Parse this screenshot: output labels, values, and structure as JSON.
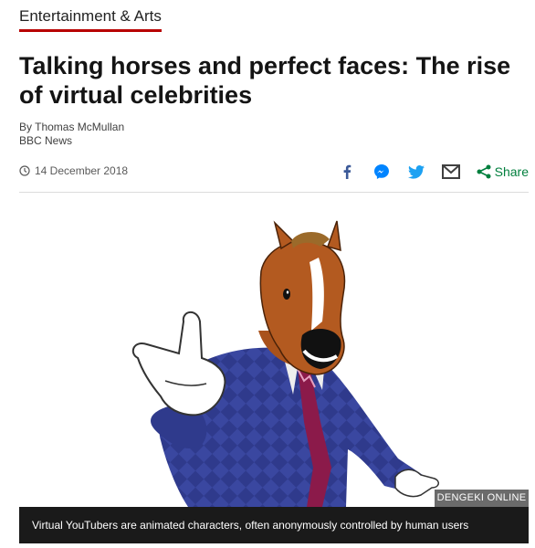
{
  "section": {
    "label": "Entertainment & Arts",
    "accent": "#b80000"
  },
  "headline": "Talking horses and perfect faces: The rise of virtual celebrities",
  "byline": {
    "author": "By Thomas McMullan",
    "outlet": "BBC News"
  },
  "meta": {
    "date": "14 December 2018",
    "clock_icon": "clock-icon",
    "share_label": "Share",
    "share_color": "#007f3d",
    "share_icons": [
      "facebook-icon",
      "messenger-icon",
      "twitter-icon",
      "email-icon",
      "share-icon"
    ]
  },
  "image": {
    "credit": "DENGEKI ONLINE",
    "caption": "Virtual YouTubers are animated characters, often anonymously controlled by human users"
  }
}
